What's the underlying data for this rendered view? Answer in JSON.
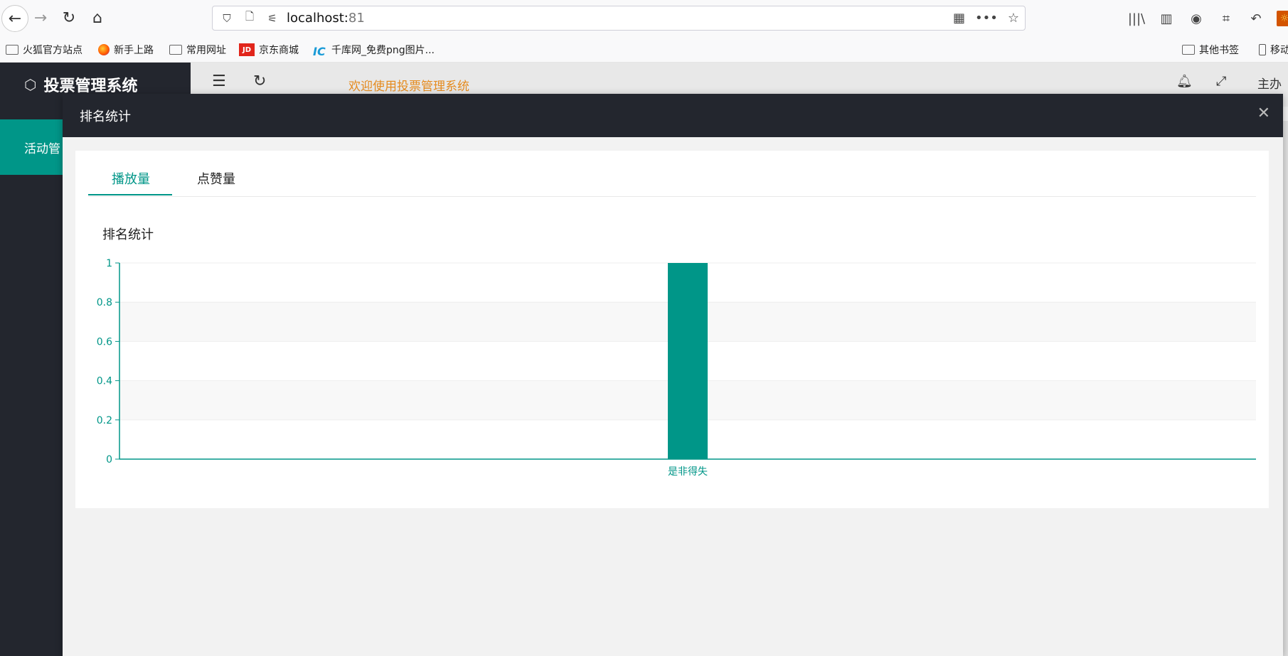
{
  "browser": {
    "url_host": "localhost:",
    "url_port": "81",
    "bookmarks": [
      "火狐官方站点",
      "新手上路",
      "常用网址",
      "京东商城",
      "千库网_免费png图片...",
      "其他书签",
      "移动"
    ]
  },
  "app": {
    "title": "投票管理系统",
    "welcome": "欢迎使用投票管理系统",
    "user_label": "主办",
    "sidebar": {
      "items": [
        {
          "label": "活动管"
        }
      ]
    }
  },
  "modal": {
    "title": "排名统计",
    "close_glyph": "✕",
    "tabs": [
      {
        "label": "播放量",
        "active": true
      },
      {
        "label": "点赞量",
        "active": false
      }
    ]
  },
  "colors": {
    "accent": "#009688",
    "dark": "#23262e",
    "welcome": "#e58b1f"
  },
  "chart_data": {
    "type": "bar",
    "title": "排名统计",
    "categories": [
      "是非得失"
    ],
    "values": [
      1
    ],
    "ylim": [
      0,
      1
    ],
    "yticks": [
      "0",
      "0.2",
      "0.4",
      "0.6",
      "0.8",
      "1"
    ],
    "xlabel": "",
    "ylabel": "",
    "grid": "horizontal bands",
    "color": "#009688"
  }
}
